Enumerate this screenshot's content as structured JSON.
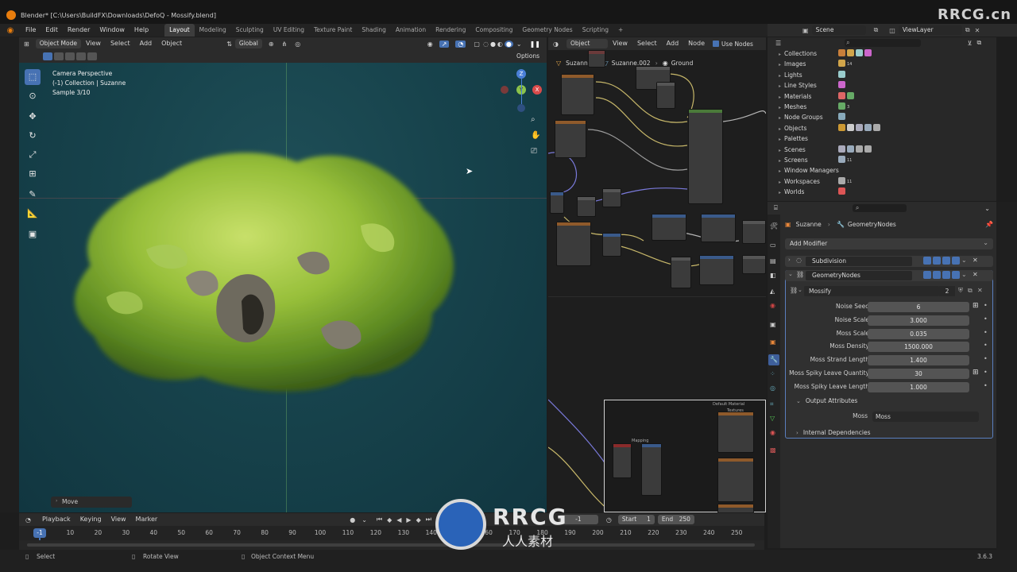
{
  "window": {
    "title": "Blender* [C:\\Users\\BuildFX\\Downloads\\DefoQ - Mossify.blend]"
  },
  "menu": [
    "File",
    "Edit",
    "Render",
    "Window",
    "Help"
  ],
  "workspaces": [
    "Layout",
    "Modeling",
    "Sculpting",
    "UV Editing",
    "Texture Paint",
    "Shading",
    "Animation",
    "Rendering",
    "Compositing",
    "Geometry Nodes",
    "Scripting",
    "+"
  ],
  "active_workspace": "Layout",
  "scene": {
    "scene_name": "Scene",
    "view_layer": "ViewLayer"
  },
  "viewport": {
    "mode": "Object Mode",
    "menus": [
      "View",
      "Select",
      "Add",
      "Object"
    ],
    "transform_orientation": "Global",
    "options_label": "Options",
    "overlay_lines": [
      "Camera Perspective",
      "(-1) Collection | Suzanne",
      "Sample 3/10"
    ],
    "gizmo_axes": [
      "Z",
      "Y",
      "X"
    ],
    "last_operator": "Move"
  },
  "node_editor": {
    "type": "Object",
    "menus": [
      "View",
      "Select",
      "Add",
      "Node"
    ],
    "use_nodes_label": "Use Nodes",
    "breadcrumb": [
      "Suzanne",
      "Suzanne.002",
      "Ground"
    ],
    "sub_window_title": "Default Material",
    "sub_window_label_textures": "Textures",
    "sub_window_label_mapping": "Mapping"
  },
  "outliner": {
    "items": [
      "Collections",
      "Images",
      "Lights",
      "Line Styles",
      "Materials",
      "Meshes",
      "Node Groups",
      "Objects",
      "Palettes",
      "Scenes",
      "Screens",
      "Window Managers",
      "Workspaces",
      "Worlds"
    ],
    "counts": {
      "Images": "14",
      "Meshes": "3",
      "Screens": "11",
      "Workspaces": "11"
    }
  },
  "properties": {
    "breadcrumb": [
      "Suzanne",
      "GeometryNodes"
    ],
    "add_modifier": "Add Modifier",
    "modifiers": [
      "Subdivision",
      "GeometryNodes"
    ],
    "node_group": {
      "name": "Mossify",
      "users": "2"
    },
    "inputs": [
      {
        "label": "Noise Seed",
        "value": "6"
      },
      {
        "label": "Noise Scale",
        "value": "3.000"
      },
      {
        "label": "Moss Scale",
        "value": "0.035"
      },
      {
        "label": "Moss Density",
        "value": "1500.000"
      },
      {
        "label": "Moss Strand Length",
        "value": "1.400"
      },
      {
        "label": "Moss Spiky Leave Quantity",
        "value": "30"
      },
      {
        "label": "Moss Spiky Leave Length",
        "value": "1.000"
      }
    ],
    "output_attributes_label": "Output Attributes",
    "output_attr": {
      "label": "Moss",
      "value": "Moss"
    },
    "internal_dependencies_label": "Internal Dependencies"
  },
  "timeline": {
    "menus": [
      "Playback",
      "Keying",
      "View",
      "Marker"
    ],
    "current_frame": "-1",
    "start_label": "Start",
    "start": "1",
    "end_label": "End",
    "end": "250",
    "ticks": [
      "10",
      "20",
      "30",
      "40",
      "50",
      "60",
      "70",
      "80",
      "90",
      "100",
      "110",
      "120",
      "130",
      "140",
      "150",
      "160",
      "170",
      "180",
      "190",
      "200",
      "210",
      "220",
      "230",
      "240",
      "250"
    ],
    "playhead": "-1"
  },
  "status": {
    "left": "Select",
    "middle": "Rotate View",
    "right": "Object Context Menu",
    "version": "3.6.3"
  },
  "watermark": {
    "brand": "RRCG",
    "sub": "人人素材",
    "corner": "RRCG.cn"
  }
}
